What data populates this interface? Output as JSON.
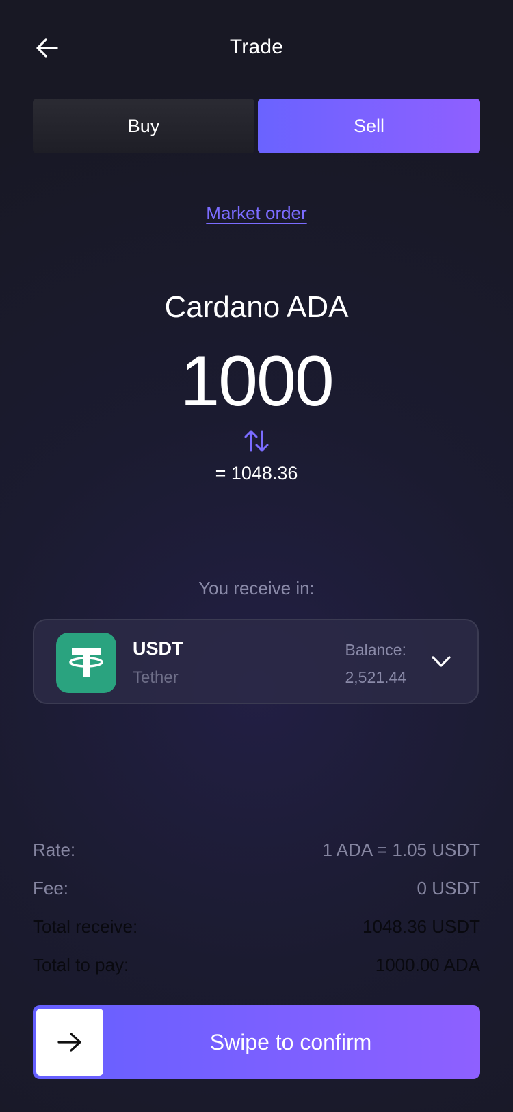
{
  "header": {
    "title": "Trade",
    "back_icon": "arrow-left-icon"
  },
  "tabs": [
    {
      "label": "Buy",
      "active": false
    },
    {
      "label": "Sell",
      "active": true
    }
  ],
  "order_type": "Market order",
  "asset": {
    "title": "Cardano ADA",
    "amount": "1000",
    "converted": "= 1048.36",
    "swap_icon": "swap-vertical-icon"
  },
  "receive": {
    "label": "You receive in:",
    "symbol": "USDT",
    "name": "Tether",
    "balance_label": "Balance:",
    "balance_value": "2,521.44",
    "logo_icon": "tether-logo-icon",
    "chevron_icon": "chevron-down-icon"
  },
  "summary": [
    {
      "label": "Rate:",
      "value": "1 ADA = 1.05 USDT"
    },
    {
      "label": "Fee:",
      "value": "0 USDT"
    },
    {
      "label": "Total receive:",
      "value": "1048.36 USDT"
    },
    {
      "label": "Total to pay:",
      "value": "1000.00 ADA"
    }
  ],
  "confirm": {
    "label": "Swipe to confirm",
    "knob_icon": "arrow-right-icon"
  },
  "colors": {
    "accent_start": "#6a63ff",
    "accent_end": "#8f60ff",
    "tether_green": "#2aa37f",
    "background": "#1b1b30"
  }
}
